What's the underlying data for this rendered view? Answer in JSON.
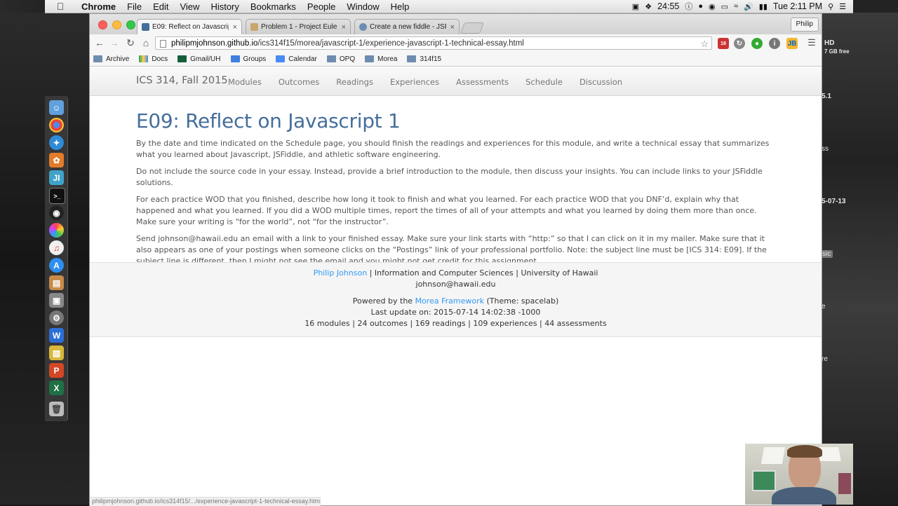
{
  "menubar": {
    "app": "Chrome",
    "items": [
      "File",
      "Edit",
      "View",
      "History",
      "Bookmarks",
      "People",
      "Window",
      "Help"
    ],
    "timer": "24:55",
    "clock": "Tue 2:11 PM"
  },
  "desktop": {
    "labels": [
      "HD",
      "7 GB free",
      "5.1",
      "ss",
      "5-07-13",
      "sic",
      "e",
      "re"
    ]
  },
  "browser": {
    "tabs": [
      {
        "title": "E09: Reflect on Javascript",
        "close": "×"
      },
      {
        "title": "Problem 1 - Project Euler",
        "close": "×"
      },
      {
        "title": "Create a new fiddle - JSFid",
        "close": "×"
      }
    ],
    "profile": "Philip",
    "url_host": "philipmjohnson.github.io",
    "url_path": "/ics314f15/morea/javascript-1/experience-javascript-1-technical-essay.html",
    "extension_badge": "18",
    "bookmarks": [
      "Archive",
      "Docs",
      "Gmail/UH",
      "Groups",
      "Calendar",
      "OPQ",
      "Morea",
      "314f15"
    ],
    "status_url": "philipmjohnson.github.io/ics314f15/.../experience-javascript-1-technical-essay.htm"
  },
  "site": {
    "brand": "ICS 314, Fall 2015",
    "nav": [
      "Modules",
      "Outcomes",
      "Readings",
      "Experiences",
      "Assessments",
      "Schedule",
      "Discussion"
    ]
  },
  "article": {
    "title": "E09: Reflect on Javascript 1",
    "paragraphs": [
      "By the date and time indicated on the Schedule page, you should finish the readings and experiences for this module, and write a technical essay that summarizes what you learned about Javascript, JSFiddle, and athletic software engineering.",
      "Do not include the source code in your essay. Instead, provide a brief introduction to the module, then discuss your insights. You can include links to your JSFiddle solutions.",
      "For each practice WOD that you finished, describe how long it took to finish and what you learned. For each practice WOD that you DNF’d, explain why that happened and what you learned. If you did a WOD multiple times, report the times of all of your attempts and what you learned by doing them more than once. Make sure your writing is “for the world”, not “for the instructor”.",
      "Send johnson@hawaii.edu an email with a link to your finished essay. Make sure your link starts with “http:” so that I can click on it in my mailer. Make sure that it also appears as one of your postings when someone clicks on the “Postings” link of your professional portfolio. Note: the subject line must be [ICS 314: E09]. If the subject line is different, then I might not see the email and you might not get credit for this assignment."
    ]
  },
  "footer": {
    "author": "Philip Johnson",
    "affiliation": " | Information and Computer Sciences | University of Hawaii",
    "email": "johnson@hawaii.edu",
    "powered_prefix": "Powered by the ",
    "framework": "Morea Framework",
    "theme": " (Theme: spacelab)",
    "last_update": "Last update on: 2015-07-14 14:02:38 -1000",
    "stats": "16 modules | 24 outcomes | 169 readings | 109 experiences | 44 assessments"
  }
}
